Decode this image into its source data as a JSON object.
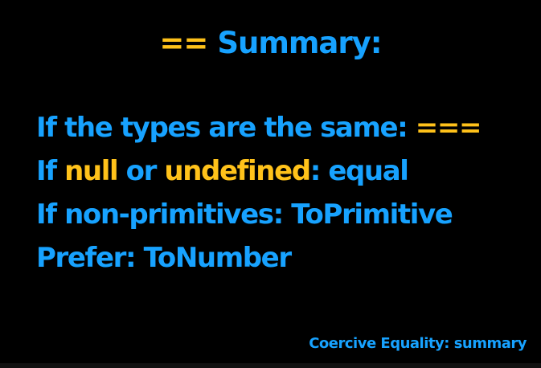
{
  "colors": {
    "background": "#000000",
    "blue": "#17a2ff",
    "yellow": "#ffc21a"
  },
  "title": {
    "operator": "==",
    "text": "Summary:"
  },
  "lines": [
    {
      "prefix": "If the types are the same: ",
      "highlight": "===",
      "suffix": ""
    },
    {
      "prefix": "If ",
      "highlight1": "null",
      "middle": " or ",
      "highlight2": "undefined",
      "suffix": ": equal"
    },
    {
      "text": "If non-primitives: ToPrimitive"
    },
    {
      "text": "Prefer: ToNumber"
    }
  ],
  "caption": "Coercive Equality: summary"
}
